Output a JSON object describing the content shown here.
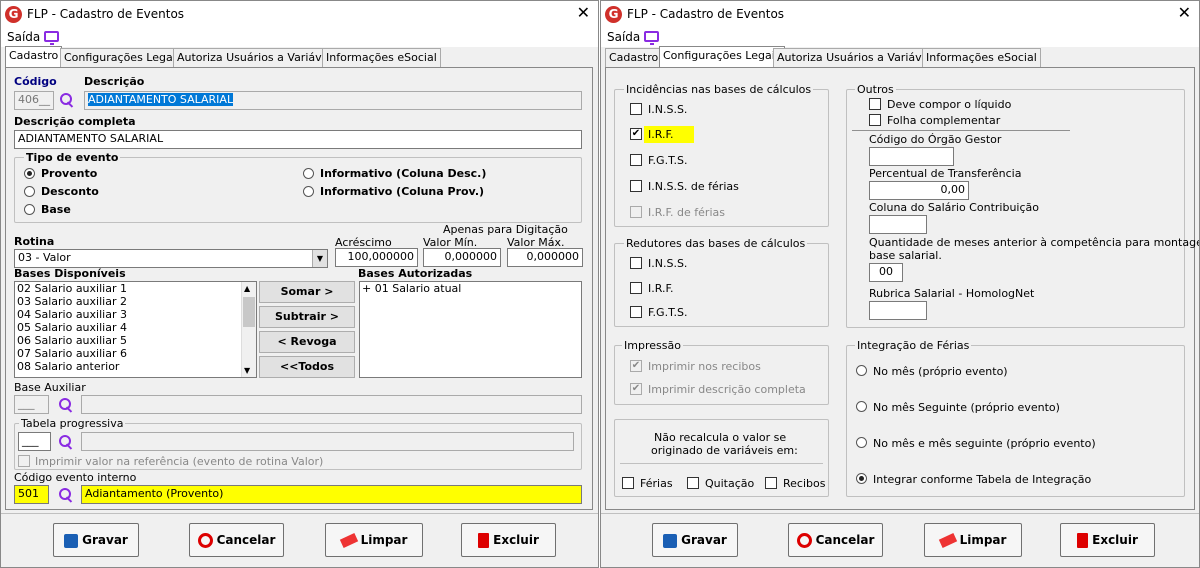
{
  "window_title": "FLP - Cadastro de Eventos",
  "menu": "Saída",
  "tabs": [
    "Cadastro",
    "Configurações Legais",
    "Autoriza Usuários a Variáveis",
    "Informações eSocial"
  ],
  "left": {
    "codigo_label": "Código",
    "codigo_value": "406__",
    "descricao_label": "Descrição",
    "descricao_value": "ADIANTAMENTO SALARIAL",
    "desc_completa_label": "Descrição completa",
    "desc_completa_value": "ADIANTAMENTO SALARIAL",
    "tipo_label": "Tipo de evento",
    "tipo_options": [
      "Provento",
      "Desconto",
      "Base",
      "Informativo (Coluna Desc.)",
      "Informativo (Coluna Prov.)"
    ],
    "rotina_label": "Rotina",
    "rotina_value": "03 - Valor",
    "acrescimo_label": "Acréscimo",
    "acrescimo_value": "100,000000",
    "apenas_label": "Apenas para Digitação",
    "valor_min_label": "Valor Mín.",
    "valor_min_value": "0,000000",
    "valor_max_label": "Valor Máx.",
    "valor_max_value": "0,000000",
    "bases_disp_label": "Bases Disponíveis",
    "bases_disp": [
      "02 Salario auxiliar 1",
      "03 Salario auxiliar 2",
      "04 Salario auxiliar 3",
      "05 Salario auxiliar 4",
      "06 Salario auxiliar 5",
      "07 Salario auxiliar 6",
      "08 Salario anterior"
    ],
    "bases_aut_label": "Bases Autorizadas",
    "bases_aut": [
      "+ 01 Salario atual"
    ],
    "somar": "Somar >",
    "subtrair": "Subtrair >",
    "revoga": "< Revoga",
    "todos": "<<Todos",
    "base_aux_label": "Base Auxiliar",
    "base_aux_value": "___",
    "tabela_label": "Tabela progressiva",
    "tabela_value": "___",
    "imprimir_ref": "Imprimir valor na referência (evento de rotina Valor)",
    "cod_interno_label": "Código evento interno",
    "cod_interno_value": "501",
    "cod_interno_desc": "Adiantamento (Provento)"
  },
  "right": {
    "incid_label": "Incidências nas bases de cálculos",
    "incid": [
      "I.N.S.S.",
      "I.R.F.",
      "F.G.T.S.",
      "I.N.S.S. de férias",
      "I.R.F. de férias"
    ],
    "redut_label": "Redutores das bases de cálculos",
    "redut": [
      "I.N.S.S.",
      "I.R.F.",
      "F.G.T.S."
    ],
    "impressao_label": "Impressão",
    "impressao": [
      "Imprimir nos recibos",
      "Imprimir descrição completa"
    ],
    "naorecalc_line1": "Não recalcula o valor se",
    "naorecalc_line2": "originado de variáveis em:",
    "naorecalc": [
      "Férias",
      "Quitação",
      "Recibos"
    ],
    "outros_label": "Outros",
    "outros": [
      "Deve compor o líquido",
      "Folha complementar"
    ],
    "orgao_label": "Código do Órgão Gestor",
    "percentual_label": "Percentual de Transferência",
    "percentual_value": "0,00",
    "coluna_label": "Coluna do Salário Contribuição",
    "qtd_label_1": "Quantidade de meses anterior à competência para montagem da",
    "qtd_label_2": "base salarial.",
    "qtd_value": "00",
    "rubrica_label": "Rubrica Salarial - HomologNet",
    "integ_label": "Integração de Férias",
    "integ": [
      "No mês (próprio evento)",
      "No mês Seguinte (próprio evento)",
      "No mês e mês seguinte (próprio evento)",
      "Integrar conforme Tabela de Integração"
    ]
  },
  "buttons": {
    "gravar": "Gravar",
    "cancelar": "Cancelar",
    "limpar": "Limpar",
    "excluir": "Excluir"
  },
  "colors": {
    "highlight": "#ffff00",
    "selection": "#0078d7",
    "accent": "#8a2be2"
  }
}
